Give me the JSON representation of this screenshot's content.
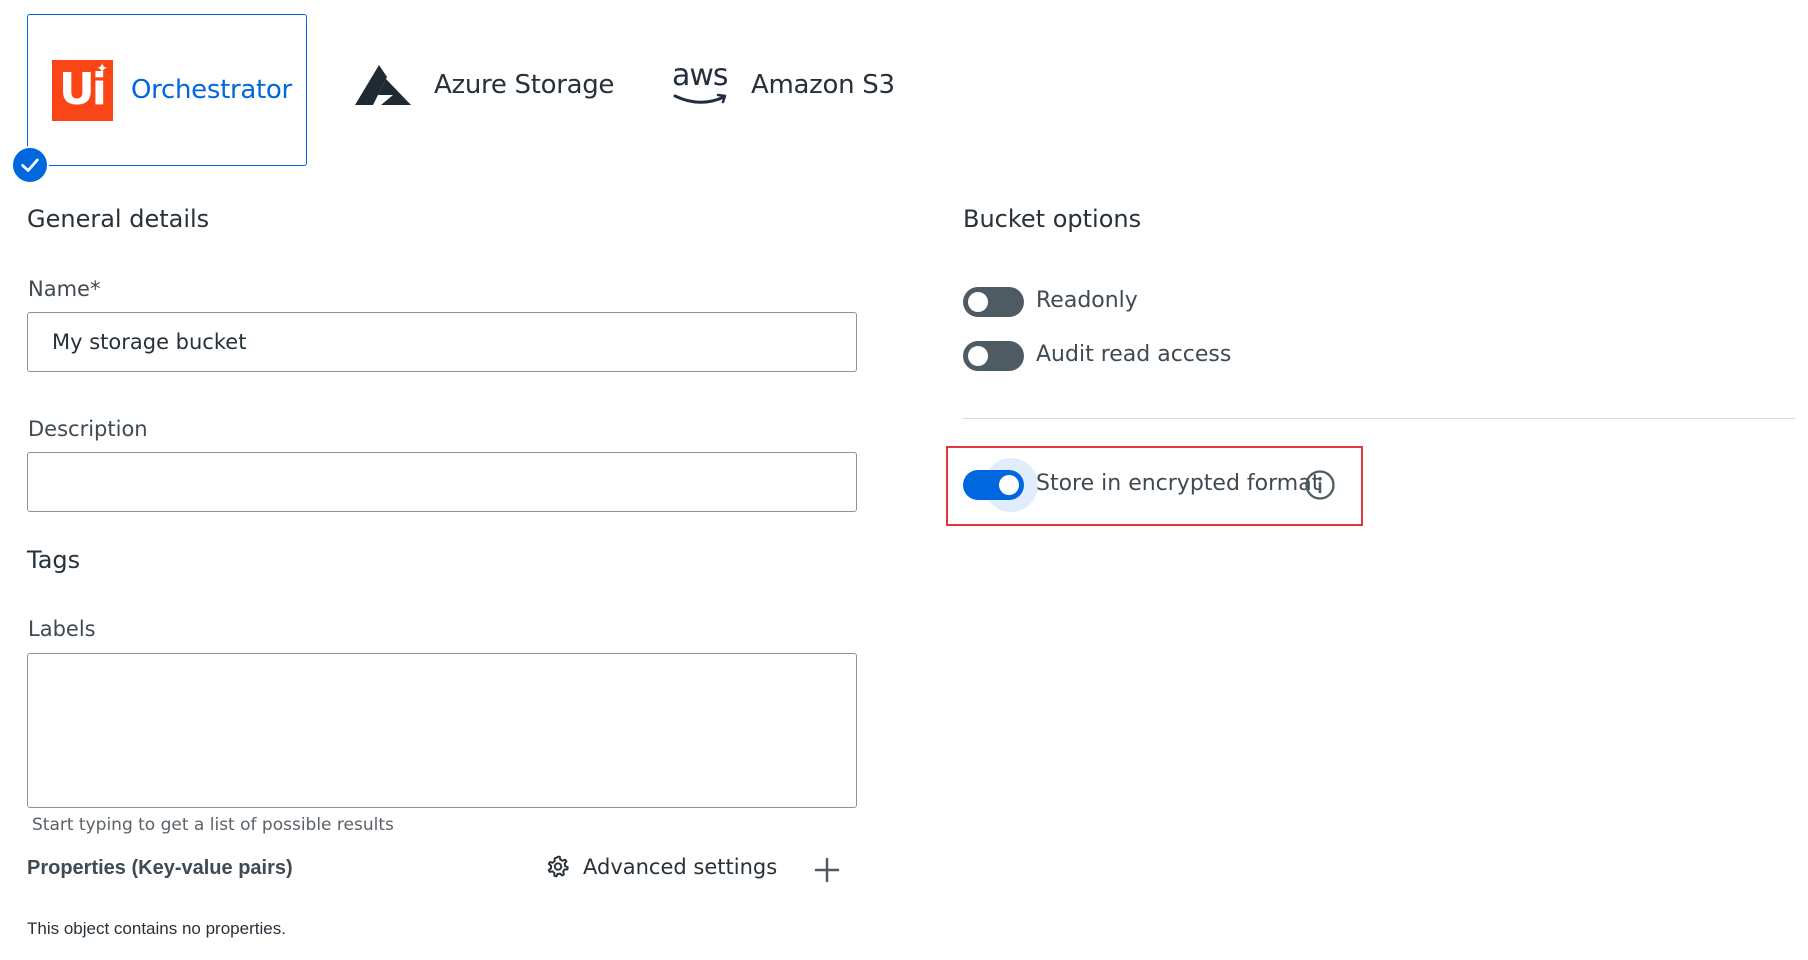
{
  "providers": [
    {
      "name": "Orchestrator",
      "logo": "uipath-logo",
      "selected": true
    },
    {
      "name": "Azure Storage",
      "logo": "azure-logo",
      "selected": false
    },
    {
      "name": "Amazon S3",
      "logo": "aws-logo",
      "logo_text": "aws",
      "selected": false
    }
  ],
  "general": {
    "title": "General details",
    "name_label": "Name*",
    "name_value": "My storage bucket",
    "description_label": "Description",
    "description_value": ""
  },
  "tags": {
    "title": "Tags",
    "labels_label": "Labels",
    "labels_helper": "Start typing to get a list of possible results",
    "properties_label": "Properties (Key-value pairs)",
    "advanced_settings_label": "Advanced settings",
    "no_properties_text": "This object contains no properties."
  },
  "bucket_options": {
    "title": "Bucket options",
    "readonly_label": "Readonly",
    "readonly_on": false,
    "audit_label": "Audit read access",
    "audit_on": false,
    "encrypted_label": "Store in encrypted format",
    "encrypted_on": true
  },
  "colors": {
    "accent": "#0067df",
    "uipath_brand": "#fa4616",
    "highlight": "#e0383e"
  }
}
